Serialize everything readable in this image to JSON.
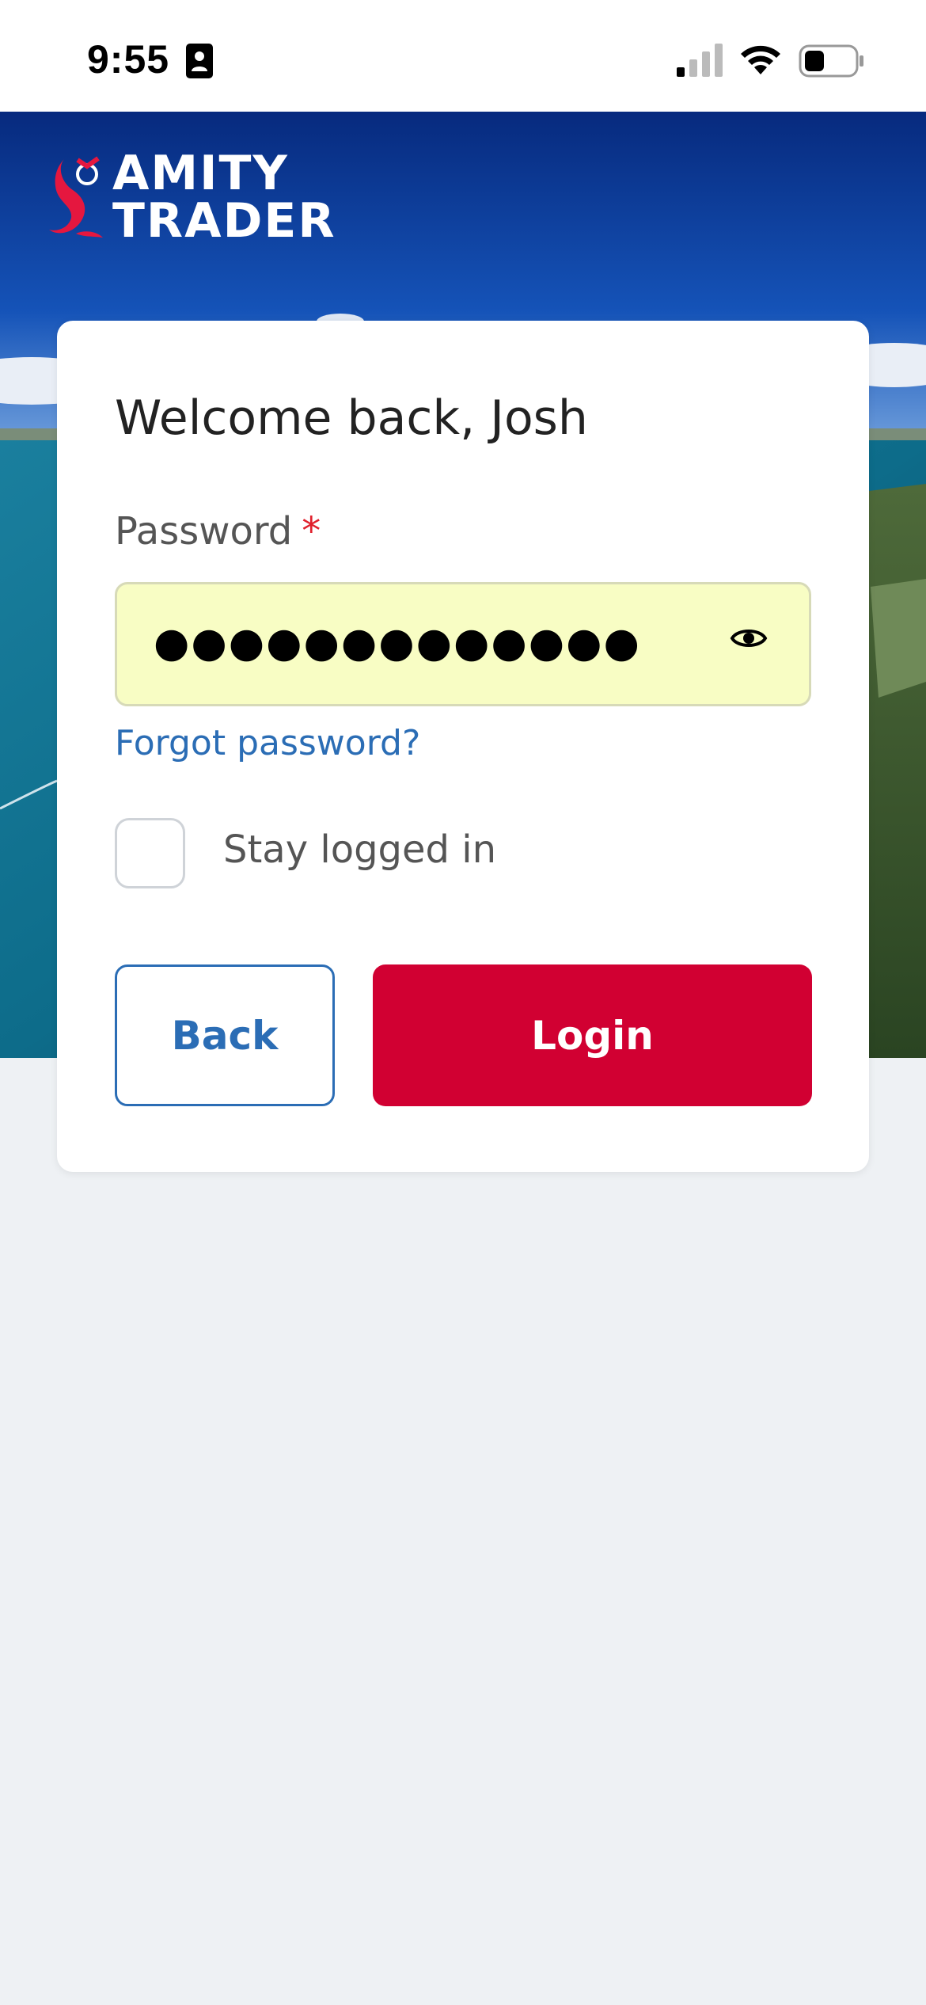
{
  "status_bar": {
    "time": "9:55",
    "icons": [
      "id-card-icon",
      "signal-icon",
      "wifi-icon",
      "battery-icon"
    ]
  },
  "brand": {
    "line1": "AMITY",
    "line2": "TRADER",
    "logo_icon": "mermaid-icon",
    "accent_color": "#d10032"
  },
  "login": {
    "welcome": "Welcome back, Josh",
    "password_label": "Password",
    "required_marker": "*",
    "password_masked": "●●●●●●●●●●●●●",
    "show_password_icon": "eye-icon",
    "forgot_link": "Forgot password?",
    "stay_logged_in": "Stay logged in",
    "stay_logged_in_checked": false,
    "back_label": "Back",
    "login_label": "Login"
  },
  "colors": {
    "primary_blue": "#2b6db5",
    "login_red": "#d10032",
    "field_fill": "#f8fdc4",
    "background": "#eef1f4"
  }
}
